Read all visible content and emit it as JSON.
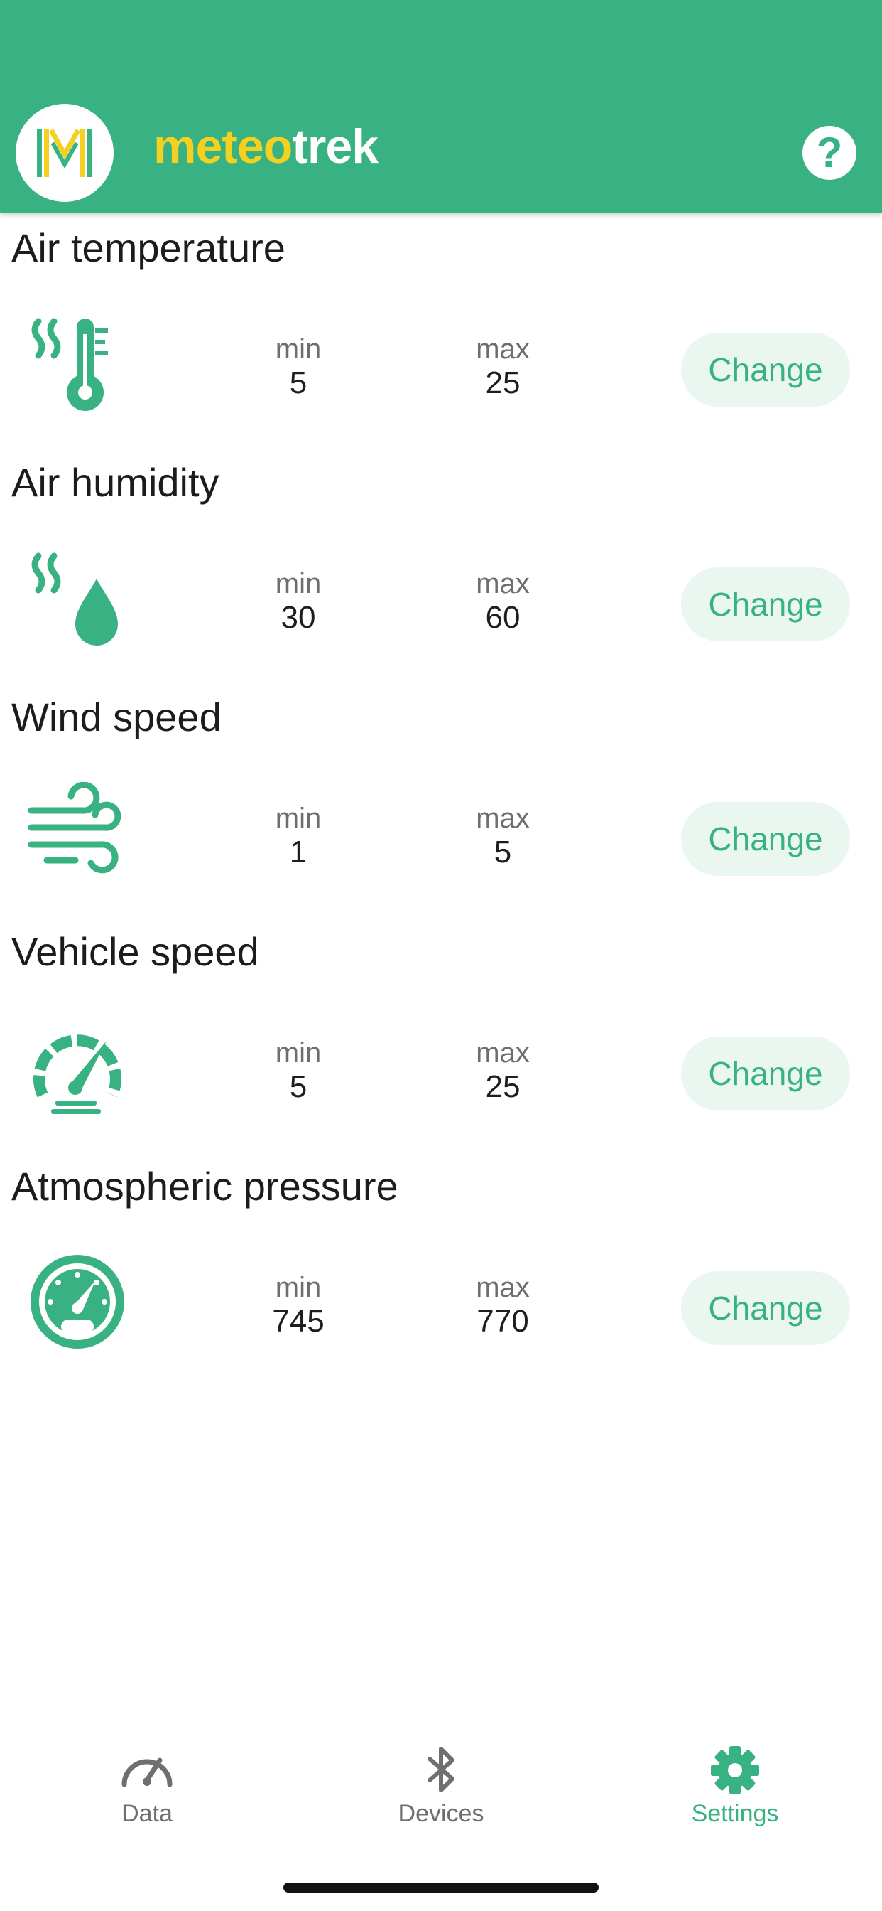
{
  "colors": {
    "primary": "#38b282",
    "accent": "#f4d11f",
    "button_bg": "#eaf6f0"
  },
  "header": {
    "brand_part1": "meteo",
    "brand_part2": "trek",
    "help_icon": "?",
    "logo_icon": "meteotrek-logo-icon"
  },
  "sensors": [
    {
      "title": "Air temperature",
      "icon": "thermometer-icon",
      "min_label": "min",
      "min_value": "5",
      "max_label": "max",
      "max_value": "25",
      "button": "Change"
    },
    {
      "title": "Air humidity",
      "icon": "humidity-drop-icon",
      "min_label": "min",
      "min_value": "30",
      "max_label": "max",
      "max_value": "60",
      "button": "Change"
    },
    {
      "title": "Wind speed",
      "icon": "wind-icon",
      "min_label": "min",
      "min_value": "1",
      "max_label": "max",
      "max_value": "5",
      "button": "Change"
    },
    {
      "title": "Vehicle speed",
      "icon": "speedometer-icon",
      "min_label": "min",
      "min_value": "5",
      "max_label": "max",
      "max_value": "25",
      "button": "Change"
    },
    {
      "title": "Atmospheric pressure",
      "icon": "barometer-icon",
      "min_label": "min",
      "min_value": "745",
      "max_label": "max",
      "max_value": "770",
      "button": "Change"
    }
  ],
  "nav": {
    "items": [
      {
        "label": "Data",
        "icon": "gauge-icon",
        "active": false
      },
      {
        "label": "Devices",
        "icon": "bluetooth-icon",
        "active": false
      },
      {
        "label": "Settings",
        "icon": "gear-icon",
        "active": true
      }
    ]
  }
}
